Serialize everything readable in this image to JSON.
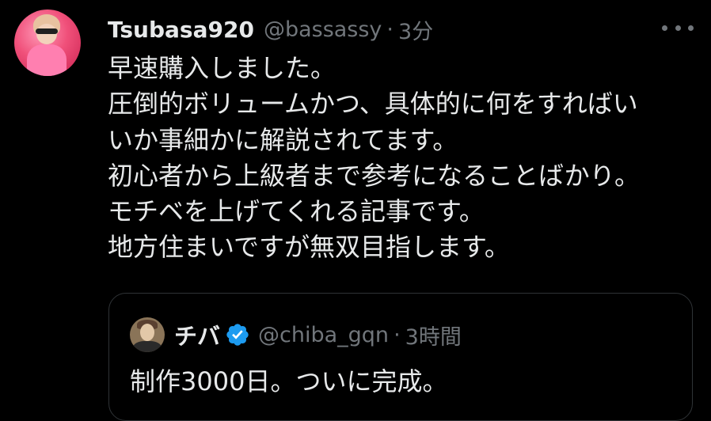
{
  "tweet": {
    "display_name": "Tsubasa920",
    "handle": "@bassassy",
    "separator": "·",
    "time": "3分",
    "more_icon": "more-horizontal-icon",
    "body_lines": [
      "早速購入しました。",
      "圧倒的ボリュームかつ、具体的に何をすればい",
      "いか事細かに解説されてます。",
      "初心者から上級者まで参考になることばかり。",
      "モチベを上げてくれる記事です。",
      "地方住まいですが無双目指します。"
    ]
  },
  "quoted_tweet": {
    "display_name": "チバ",
    "verified_icon": "verified-badge-icon",
    "handle": "@chiba_gqn",
    "separator": "·",
    "time": "3時間",
    "text": "制作3000日。ついに完成。"
  },
  "colors": {
    "background": "#000000",
    "text_primary": "#e7e9ea",
    "text_secondary": "#71767b",
    "border": "#2f3336",
    "verified": "#1d9bf0"
  }
}
